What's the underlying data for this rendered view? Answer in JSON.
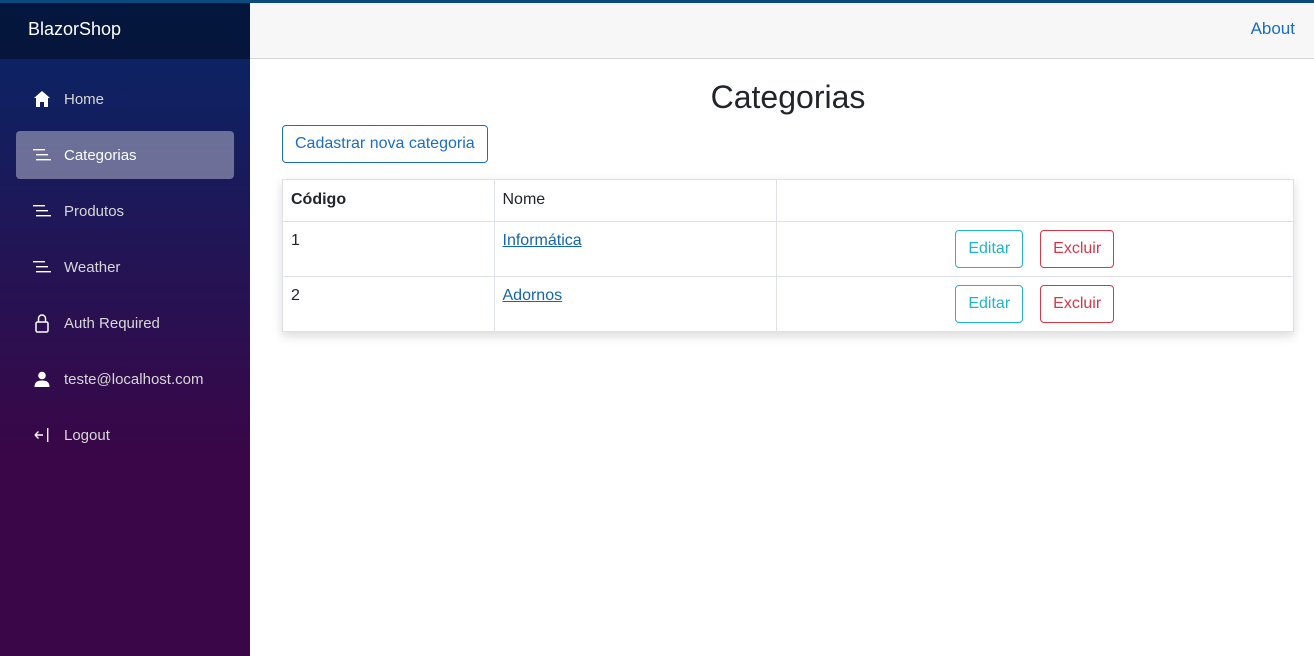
{
  "app": {
    "brand": "BlazorShop"
  },
  "sidebar": {
    "items": [
      {
        "label": "Home",
        "icon": "home-icon"
      },
      {
        "label": "Categorias",
        "icon": "list-icon",
        "active": true
      },
      {
        "label": "Produtos",
        "icon": "list-icon"
      },
      {
        "label": "Weather",
        "icon": "list-icon"
      },
      {
        "label": "Auth Required",
        "icon": "lock-icon"
      },
      {
        "label": "teste@localhost.com",
        "icon": "user-icon"
      },
      {
        "label": "Logout",
        "icon": "logout-icon"
      }
    ]
  },
  "topbar": {
    "about_label": "About"
  },
  "page": {
    "title": "Categorias",
    "new_button_label": "Cadastrar nova categoria"
  },
  "table": {
    "headers": [
      "Código",
      "Nome",
      ""
    ],
    "rows": [
      {
        "code": "1",
        "name": "Informática",
        "edit_label": "Editar",
        "delete_label": "Excluir"
      },
      {
        "code": "2",
        "name": "Adornos",
        "edit_label": "Editar",
        "delete_label": "Excluir"
      }
    ]
  },
  "colors": {
    "sidebar_gradient_top": "#052767",
    "sidebar_gradient_bottom": "#3a0647",
    "link": "#1b6ec2",
    "edit": "#1fb4cc",
    "delete": "#dc3545"
  }
}
